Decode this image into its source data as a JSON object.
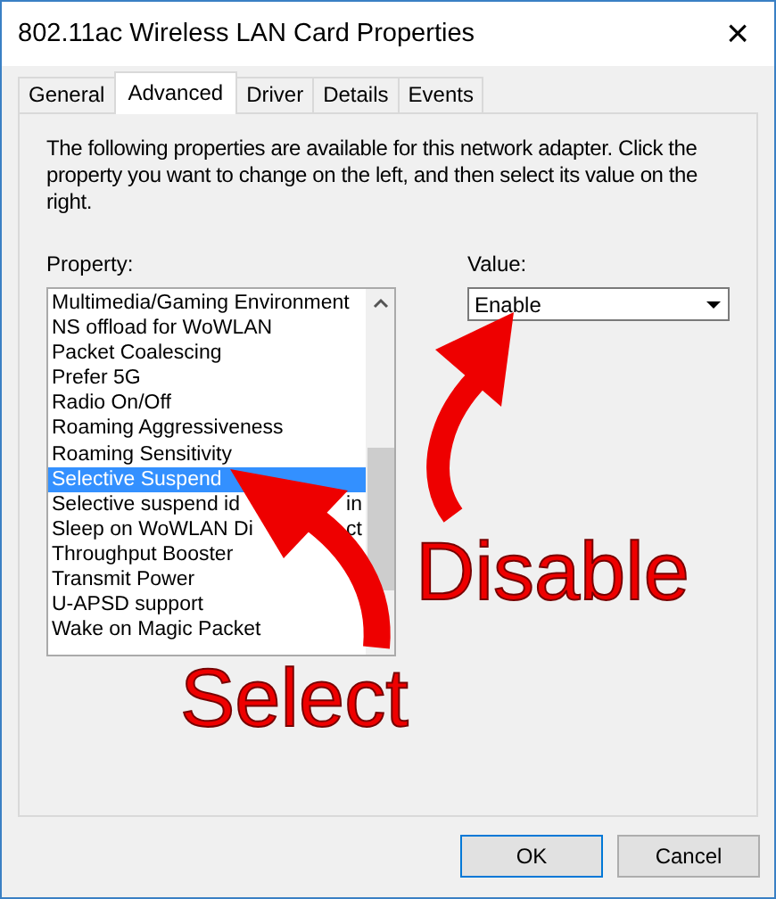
{
  "window": {
    "title": "802.11ac Wireless LAN Card Properties",
    "close": "×"
  },
  "tabs": [
    {
      "label": "General",
      "selected": false
    },
    {
      "label": "Advanced",
      "selected": true
    },
    {
      "label": "Driver",
      "selected": false
    },
    {
      "label": "Details",
      "selected": false
    },
    {
      "label": "Events",
      "selected": false
    }
  ],
  "description": "The following properties are available for this network adapter. Click the property you want to change on the left, and then select its value on the right.",
  "property": {
    "label": "Property:",
    "items": [
      {
        "label": "Multimedia/Gaming Environment",
        "selected": false
      },
      {
        "label": "NS offload for WoWLAN",
        "selected": false
      },
      {
        "label": "Packet Coalescing",
        "selected": false
      },
      {
        "label": "Prefer 5G",
        "selected": false
      },
      {
        "label": "Radio On/Off",
        "selected": false
      },
      {
        "label": "Roaming Aggressiveness",
        "selected": false
      },
      {
        "label": "Roaming Sensitivity",
        "selected": false
      },
      {
        "label": "Selective Suspend",
        "selected": true
      },
      {
        "label": "Selective suspend id",
        "tail": "in",
        "selected": false
      },
      {
        "label": "Sleep on WoWLAN Di",
        "tail": "ct",
        "selected": false
      },
      {
        "label": "Throughput Booster",
        "selected": false
      },
      {
        "label": "Transmit Power",
        "selected": false
      },
      {
        "label": "U-APSD support",
        "selected": false
      },
      {
        "label": "Wake on Magic Packet",
        "selected": false
      }
    ]
  },
  "value": {
    "label": "Value:",
    "selected": "Enable"
  },
  "annotations": [
    {
      "text": "Disable"
    },
    {
      "text": "Select"
    }
  ],
  "buttons": [
    {
      "label": "OK",
      "default": true
    },
    {
      "label": "Cancel",
      "default": false
    }
  ]
}
